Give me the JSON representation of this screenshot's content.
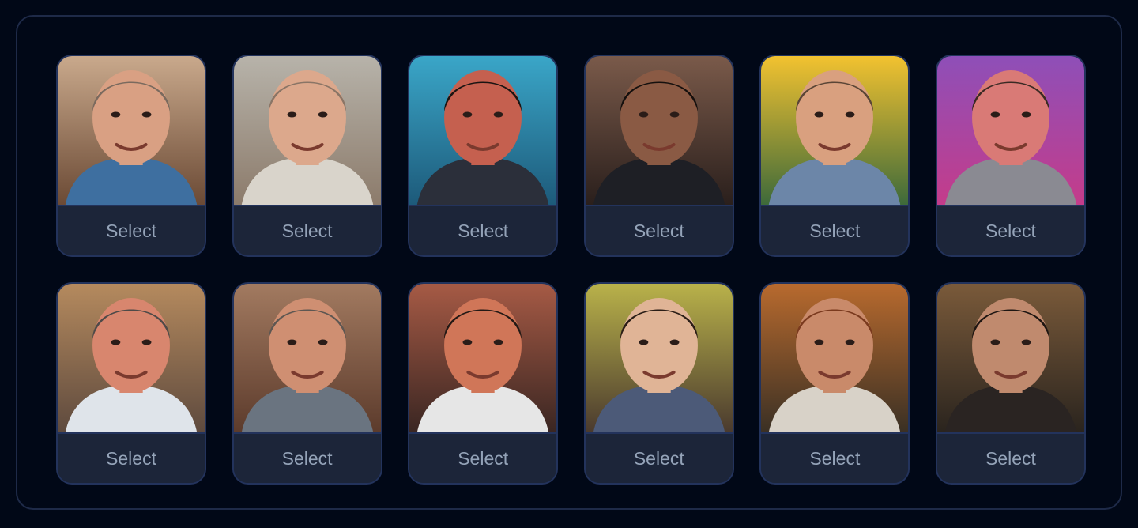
{
  "cards": [
    {
      "select_label": "Select",
      "bg_top": "#c9a98c",
      "bg_bottom": "#6b4a35",
      "skin": "#d9a083",
      "hair": "#7a6a5e",
      "shirt": "#3e6fa0",
      "icon": "person-portrait-icon"
    },
    {
      "select_label": "Select",
      "bg_top": "#b7b3aa",
      "bg_bottom": "#8c7b6b",
      "skin": "#dca88c",
      "hair": "#8a7566",
      "shirt": "#d9d4cb",
      "icon": "person-portrait-icon"
    },
    {
      "select_label": "Select",
      "bg_top": "#3aa6c8",
      "bg_bottom": "#1d5a7a",
      "skin": "#c5604f",
      "hair": "#1a1412",
      "shirt": "#2b2f3a",
      "icon": "person-portrait-icon"
    },
    {
      "select_label": "Select",
      "bg_top": "#7a5a4a",
      "bg_bottom": "#2a1f1c",
      "skin": "#8a5a44",
      "hair": "#15100e",
      "shirt": "#1e1f25",
      "icon": "person-portrait-icon"
    },
    {
      "select_label": "Select",
      "bg_top": "#f2c230",
      "bg_bottom": "#3e6a3a",
      "skin": "#d9a07f",
      "hair": "#5a4536",
      "shirt": "#6c86a8",
      "icon": "person-portrait-icon"
    },
    {
      "select_label": "Select",
      "bg_top": "#8e4fb8",
      "bg_bottom": "#c43c8a",
      "skin": "#d97a76",
      "hair": "#3a2a24",
      "shirt": "#8a8a92",
      "icon": "person-portrait-icon"
    },
    {
      "select_label": "Select",
      "bg_top": "#b58a5e",
      "bg_bottom": "#5e4a3e",
      "skin": "#d8866e",
      "hair": "#4e4a48",
      "shirt": "#dfe4ea",
      "icon": "person-portrait-icon"
    },
    {
      "select_label": "Select",
      "bg_top": "#a27a60",
      "bg_bottom": "#5c3b2c",
      "skin": "#cf8f72",
      "hair": "#5e5752",
      "shirt": "#6a7480",
      "icon": "person-portrait-icon"
    },
    {
      "select_label": "Select",
      "bg_top": "#a65a45",
      "bg_bottom": "#3a2622",
      "skin": "#d07658",
      "hair": "#231915",
      "shirt": "#e6e6e6",
      "icon": "person-portrait-icon"
    },
    {
      "select_label": "Select",
      "bg_top": "#b9b24a",
      "bg_bottom": "#4a3a2e",
      "skin": "#e0b496",
      "hair": "#2a1d16",
      "shirt": "#4c5a78",
      "icon": "person-portrait-icon"
    },
    {
      "select_label": "Select",
      "bg_top": "#b86a2e",
      "bg_bottom": "#3a3024",
      "skin": "#c98a6a",
      "hair": "#7a3a1e",
      "shirt": "#d8d2c8",
      "icon": "person-portrait-icon"
    },
    {
      "select_label": "Select",
      "bg_top": "#7a5a3a",
      "bg_bottom": "#2a241e",
      "skin": "#c08a6e",
      "hair": "#1e1612",
      "shirt": "#2a2422",
      "icon": "person-portrait-icon"
    }
  ]
}
